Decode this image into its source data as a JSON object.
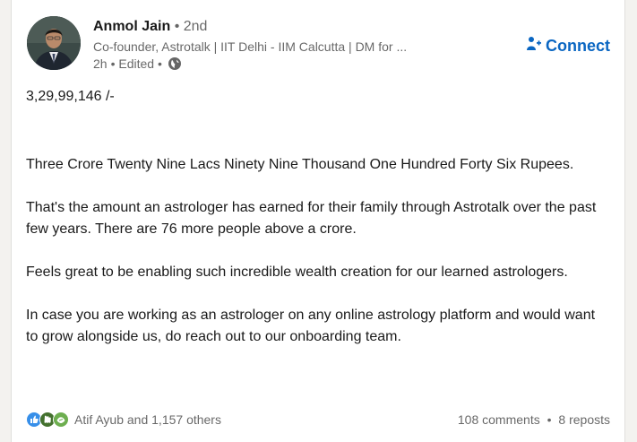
{
  "author": {
    "name": "Anmol Jain",
    "degree": "• 2nd",
    "headline": "Co-founder, Astrotalk | IIT Delhi - IIM Calcutta | DM for ...",
    "time": "2h",
    "edited": "• Edited •"
  },
  "connect_label": "Connect",
  "post": {
    "amount": "3,29,99,146 /-",
    "line_words": "Three Crore Twenty Nine Lacs Ninety Nine Thousand One Hundred Forty Six Rupees.",
    "line_earned": "That's the amount an astrologer has earned for their family through Astrotalk over the past few years. There are 76 more people above a crore.",
    "line_feels": "Feels great to be enabling such incredible wealth creation for our learned astrologers.",
    "line_case": "In case you are working as an astrologer on any online astrology platform and would want to grow alongside us, do reach out to our onboarding team."
  },
  "social": {
    "reactions_text": "Atif Ayub and 1,157 others",
    "comments": "108 comments",
    "separator": "•",
    "reposts": "8 reposts"
  },
  "colors": {
    "accent": "#0a66c2",
    "like": "#378fe9",
    "celebrate": "#44712e",
    "support": "#6dae4f"
  },
  "icons": {
    "connect": "add-person-icon",
    "visibility": "globe-icon",
    "reactions": [
      "like-icon",
      "celebrate-icon",
      "support-icon"
    ]
  }
}
